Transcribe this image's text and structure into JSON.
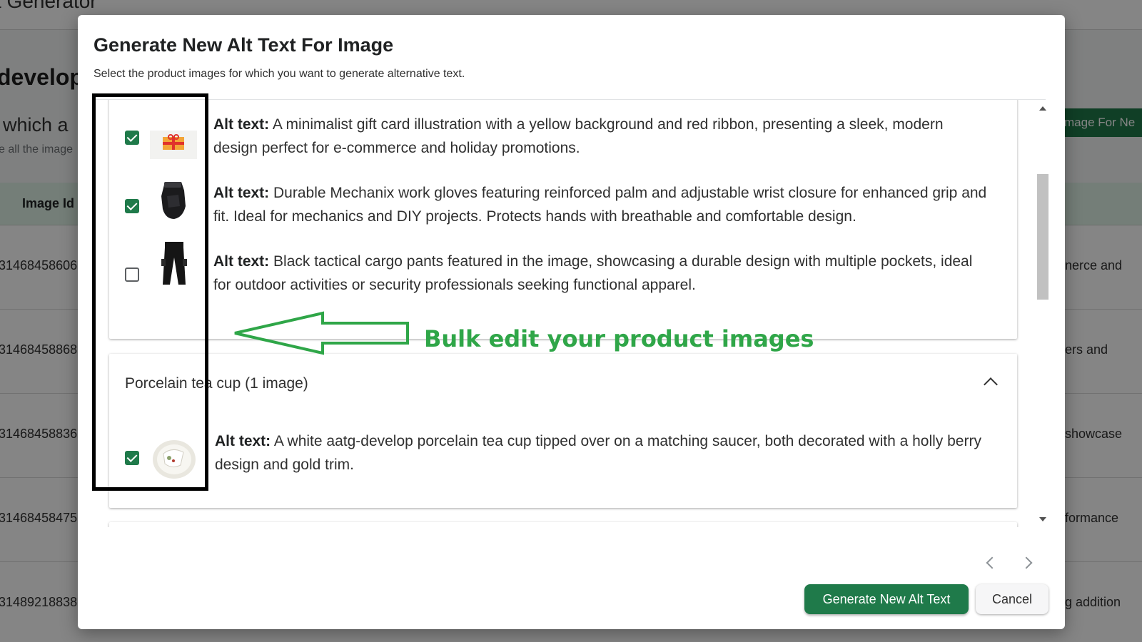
{
  "background": {
    "app_title": "t Generator",
    "heading": "develop",
    "subheading": "which a",
    "subtext": "e all the image",
    "primary_button": "mage For Ne",
    "column_label": "Image Id",
    "rows": [
      {
        "id": "31468458606",
        "text": "nerce and"
      },
      {
        "id": "31468458868",
        "text": "ers and"
      },
      {
        "id": "31468458836",
        "text": "showcase"
      },
      {
        "id": "31468458475",
        "text": "formance"
      },
      {
        "id": "31489218838",
        "text": "g addition"
      }
    ]
  },
  "modal": {
    "title": "Generate New Alt Text For Image",
    "subtitle": "Select the product images for which you want to generate alternative text.",
    "alt_label": "Alt text:",
    "items": [
      {
        "checked": true,
        "thumb": "gift-card-thumbnail",
        "alt": "A minimalist gift card illustration with a yellow background and red ribbon, presenting a sleek, modern design perfect for e-commerce and holiday promotions."
      },
      {
        "checked": true,
        "thumb": "work-gloves-thumbnail",
        "alt": "Durable Mechanix work gloves featuring reinforced palm and adjustable wrist closure for enhanced grip and fit. Ideal for mechanics and DIY projects. Protects hands with breathable and comfortable design."
      },
      {
        "checked": false,
        "thumb": "cargo-pants-thumbnail",
        "alt": "Black tactical cargo pants featured in the image, showcasing a durable design with multiple pockets, ideal for outdoor activities or security professionals seeking functional apparel."
      }
    ],
    "group": {
      "title": "Porcelain tea cup (1 image)",
      "items": [
        {
          "checked": true,
          "thumb": "tea-cup-thumbnail",
          "alt": "A white aatg-develop porcelain tea cup tipped over on a matching saucer, both decorated with a holly berry design and gold trim."
        }
      ]
    },
    "generate_button": "Generate New Alt Text",
    "cancel_button": "Cancel"
  },
  "annotation": {
    "text": "Bulk edit your product images",
    "color": "#2fa648"
  },
  "colors": {
    "primary": "#1f7a4a",
    "table_header": "#dff1e6"
  }
}
